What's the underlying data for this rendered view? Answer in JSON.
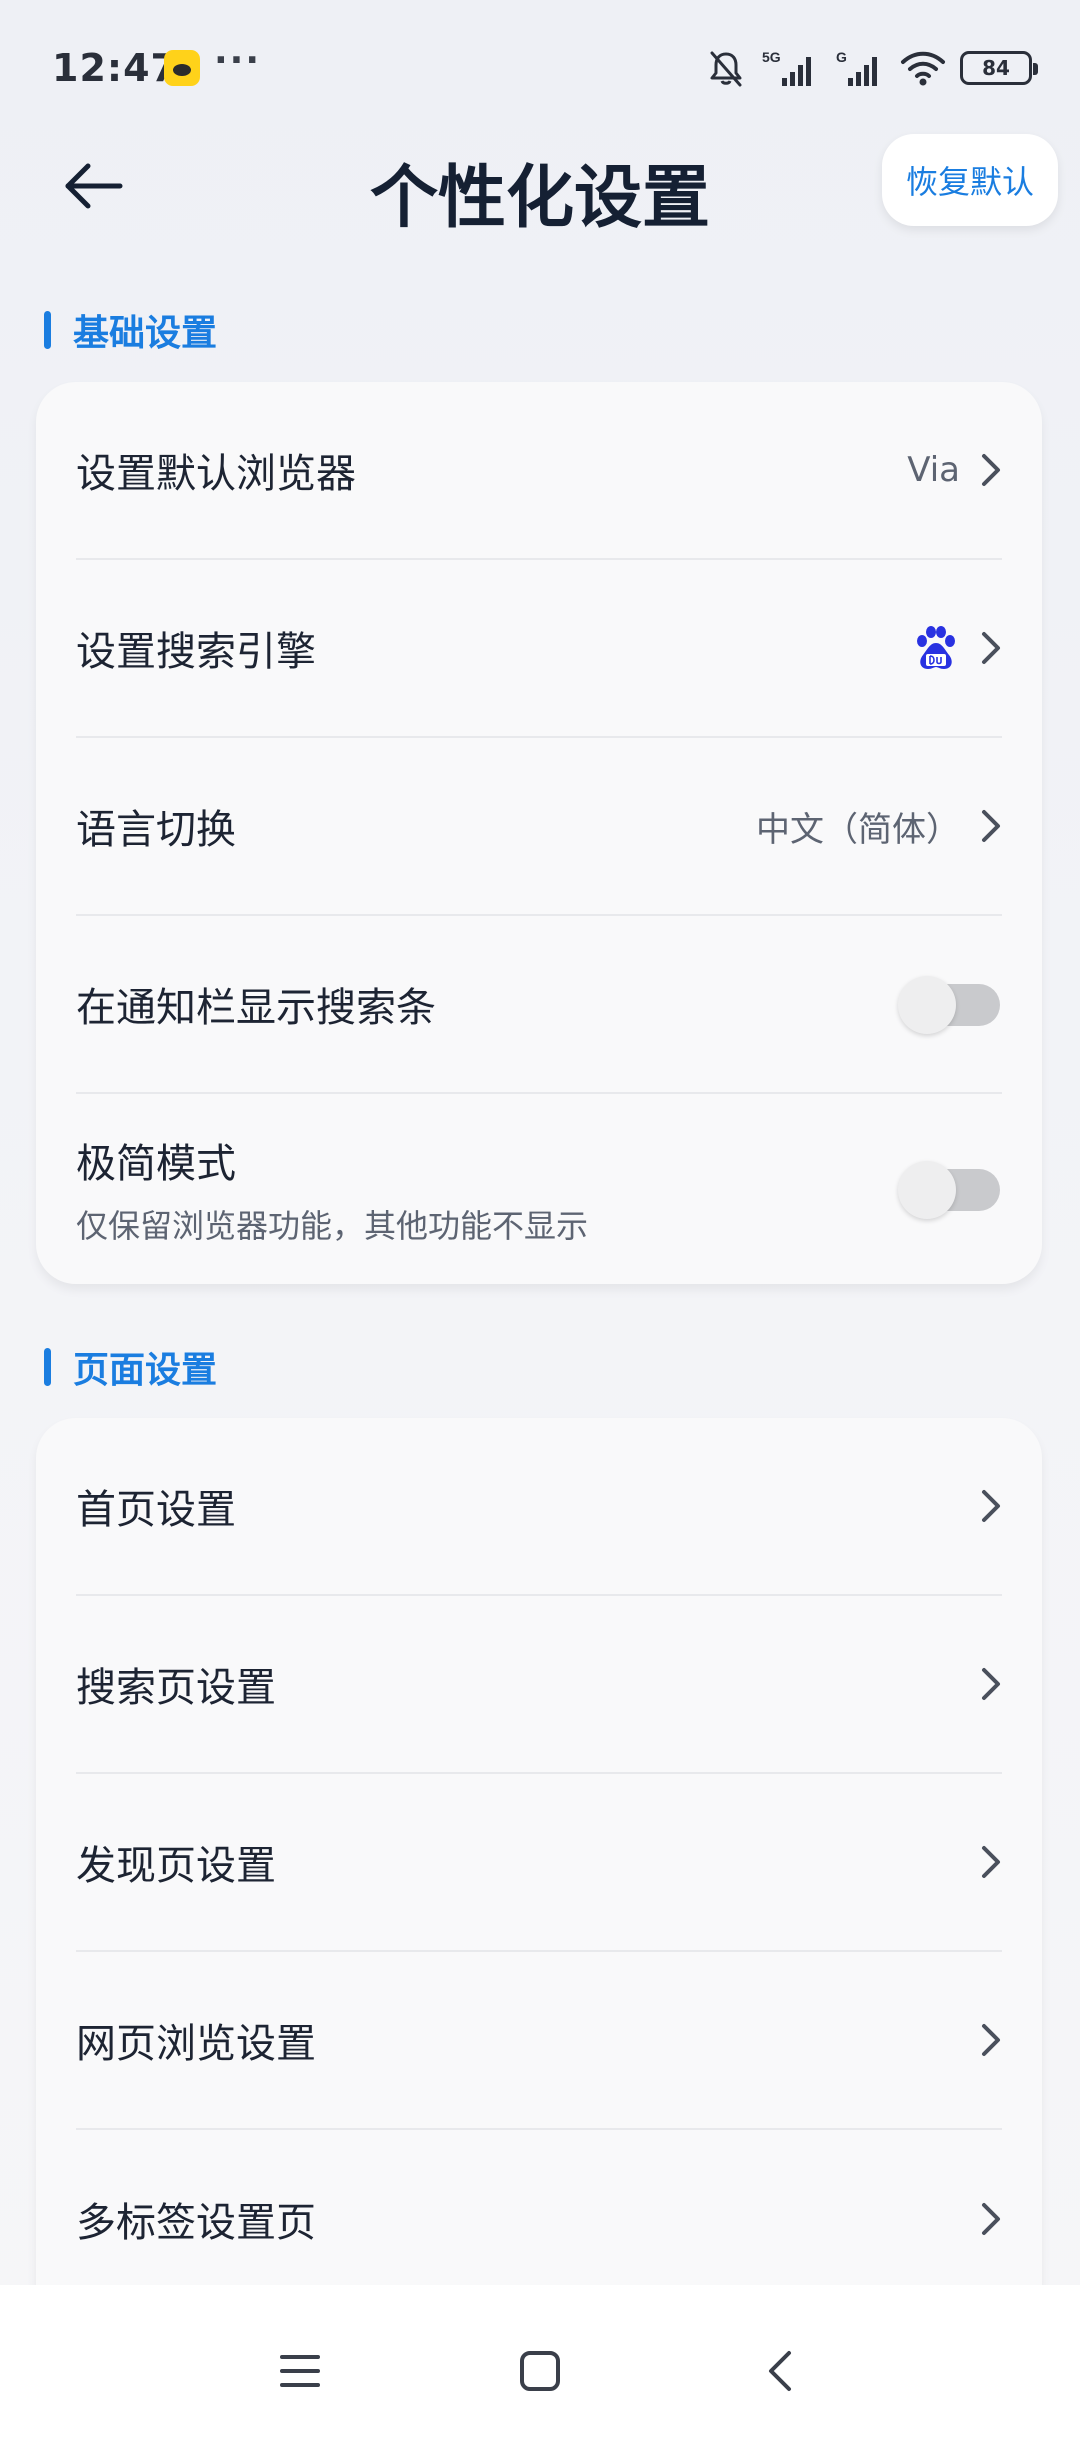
{
  "status_bar": {
    "time": "12:47",
    "dots": "···",
    "network_5g": "5G",
    "network_g": "G",
    "battery": "84",
    "icons": [
      "app-notification-icon",
      "bell-muted-icon",
      "signal-icon",
      "wifi-icon",
      "battery-icon"
    ]
  },
  "header": {
    "title": "个性化设置",
    "restore_label": "恢复默认"
  },
  "sections": [
    {
      "title": "基础设置",
      "rows": [
        {
          "label": "设置默认浏览器",
          "value": "Via",
          "type": "nav"
        },
        {
          "label": "设置搜索引擎",
          "value": "",
          "icon": "baidu-icon",
          "type": "nav"
        },
        {
          "label": "语言切换",
          "value": "中文（简体）",
          "type": "nav"
        },
        {
          "label": "在通知栏显示搜索条",
          "type": "toggle",
          "on": false
        },
        {
          "label": "极简模式",
          "sub": "仅保留浏览器功能，其他功能不显示",
          "type": "toggle",
          "on": false
        }
      ]
    },
    {
      "title": "页面设置",
      "rows": [
        {
          "label": "首页设置",
          "type": "nav"
        },
        {
          "label": "搜索页设置",
          "type": "nav"
        },
        {
          "label": "发现页设置",
          "type": "nav"
        },
        {
          "label": "网页浏览设置",
          "type": "nav"
        },
        {
          "label": "多标签设置页",
          "type": "nav"
        }
      ]
    }
  ],
  "nav_bar": {
    "icons": [
      "menu-icon",
      "home-icon",
      "back-icon"
    ]
  },
  "colors": {
    "accent": "#1a7de0",
    "title": "#152033",
    "text": "#1d2433",
    "secondary": "#5d6472",
    "baidu_blue": "#2932e1"
  }
}
